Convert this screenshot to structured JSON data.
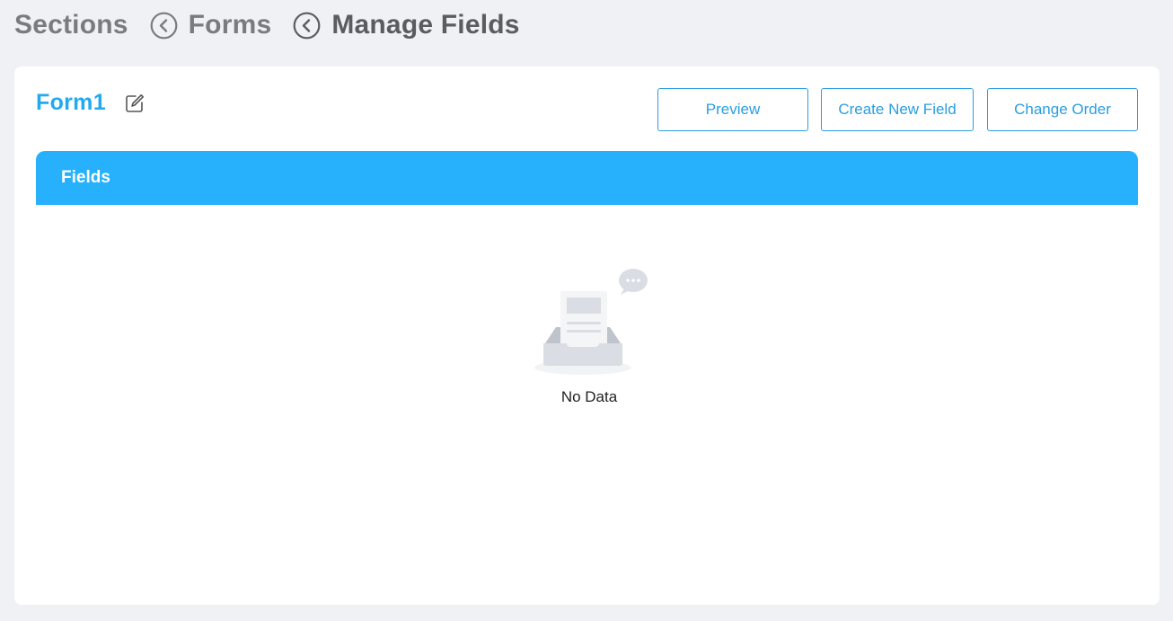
{
  "breadcrumb": {
    "items": [
      {
        "label": "Sections"
      },
      {
        "label": "Forms"
      },
      {
        "label": "Manage Fields"
      }
    ]
  },
  "form": {
    "title": "Form1"
  },
  "toolbar": {
    "preview_label": "Preview",
    "create_label": "Create New Field",
    "order_label": "Change Order"
  },
  "fields_panel": {
    "header": "Fields",
    "empty_text": "No Data"
  },
  "icons": {
    "back": "chevron-left-circle-icon",
    "edit": "edit-icon",
    "empty": "empty-inbox-icon"
  },
  "colors": {
    "accent": "#27b1fd",
    "link": "#2a9de0",
    "title": "#22aaee",
    "background": "#f0f1f5"
  }
}
